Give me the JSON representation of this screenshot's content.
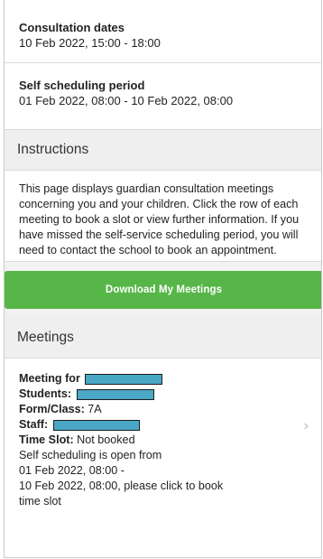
{
  "consultation": {
    "dates_label": "Consultation dates",
    "dates_value": "10 Feb 2022, 15:00 - 18:00",
    "scheduling_label": "Self scheduling period",
    "scheduling_value": "01 Feb 2022, 08:00 - 10 Feb 2022, 08:00"
  },
  "instructions": {
    "title": "Instructions",
    "text": "This page displays guardian consultation meetings concerning you and your children. Click the row of each meeting to book a slot or view further information. If you have missed the self-service scheduling period, you will need to contact the school to book an appointment."
  },
  "download": {
    "label": "Download My Meetings"
  },
  "meetings": {
    "title": "Meetings",
    "item": {
      "meeting_for_label": "Meeting for",
      "students_label": "Students:",
      "form_label": "Form/Class:",
      "form_value": "7A",
      "staff_label": "Staff:",
      "time_slot_label": "Time Slot:",
      "time_slot_value": "Not booked",
      "note_line1": "Self scheduling is open from",
      "note_line2": "01 Feb 2022, 08:00 -",
      "note_line3": "10 Feb 2022, 08:00, please click to book",
      "note_line4": "time slot"
    }
  },
  "icons": {
    "row_chevron": "chevron-right-icon"
  },
  "colors": {
    "download_button": "#56b648",
    "redaction": "#4aa7c5"
  }
}
